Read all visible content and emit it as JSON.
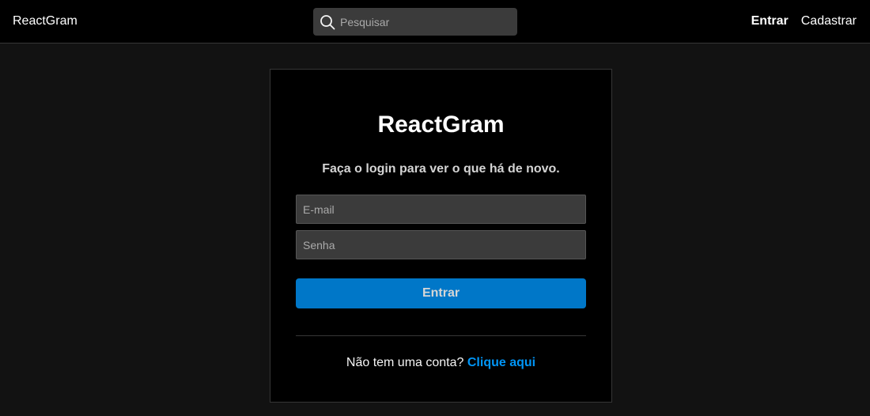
{
  "navbar": {
    "brand": "ReactGram",
    "search": {
      "placeholder": "Pesquisar",
      "icon": "search-icon"
    },
    "links": [
      {
        "label": "Entrar",
        "active": true
      },
      {
        "label": "Cadastrar",
        "active": false
      }
    ]
  },
  "login": {
    "title": "ReactGram",
    "subtitle": "Faça o login para ver o que há de novo.",
    "email_placeholder": "E-mail",
    "password_placeholder": "Senha",
    "submit_label": "Entrar",
    "signup_prompt": "Não tem uma conta?",
    "signup_link": "Clique aqui"
  },
  "colors": {
    "page_bg": "#121212",
    "navbar_bg": "#000000",
    "input_bg": "#3b3b3b",
    "button_bg": "#0077c8",
    "link": "#0095f6"
  }
}
